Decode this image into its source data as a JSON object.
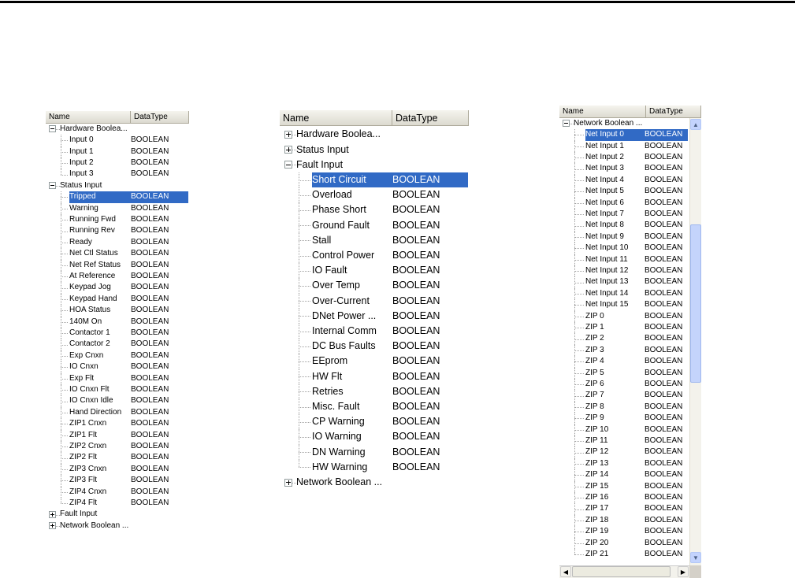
{
  "columns": {
    "name": "Name",
    "datatype": "DataType"
  },
  "colors": {
    "selection": "#316ac5",
    "header": "#ece9d8",
    "scrollbar": "#c4d4fb"
  },
  "panels": [
    {
      "id": "left",
      "rows": [
        {
          "level": 0,
          "label": "Hardware Boolea...",
          "expander": "minus"
        },
        {
          "level": 1,
          "label": "Input 0",
          "type": "BOOLEAN"
        },
        {
          "level": 1,
          "label": "Input 1",
          "type": "BOOLEAN"
        },
        {
          "level": 1,
          "label": "Input 2",
          "type": "BOOLEAN"
        },
        {
          "level": 1,
          "label": "Input 3",
          "type": "BOOLEAN"
        },
        {
          "level": 0,
          "label": "Status Input",
          "expander": "minus"
        },
        {
          "level": 1,
          "label": "Tripped",
          "type": "BOOLEAN",
          "selected": true
        },
        {
          "level": 1,
          "label": "Warning",
          "type": "BOOLEAN"
        },
        {
          "level": 1,
          "label": "Running Fwd",
          "type": "BOOLEAN"
        },
        {
          "level": 1,
          "label": "Running Rev",
          "type": "BOOLEAN"
        },
        {
          "level": 1,
          "label": "Ready",
          "type": "BOOLEAN"
        },
        {
          "level": 1,
          "label": "Net Ctl Status",
          "type": "BOOLEAN"
        },
        {
          "level": 1,
          "label": "Net Ref Status",
          "type": "BOOLEAN"
        },
        {
          "level": 1,
          "label": "At Reference",
          "type": "BOOLEAN"
        },
        {
          "level": 1,
          "label": "Keypad Jog",
          "type": "BOOLEAN"
        },
        {
          "level": 1,
          "label": "Keypad Hand",
          "type": "BOOLEAN"
        },
        {
          "level": 1,
          "label": "HOA Status",
          "type": "BOOLEAN"
        },
        {
          "level": 1,
          "label": "140M On",
          "type": "BOOLEAN"
        },
        {
          "level": 1,
          "label": "Contactor 1",
          "type": "BOOLEAN"
        },
        {
          "level": 1,
          "label": "Contactor 2",
          "type": "BOOLEAN"
        },
        {
          "level": 1,
          "label": "Exp Cnxn",
          "type": "BOOLEAN"
        },
        {
          "level": 1,
          "label": "IO Cnxn",
          "type": "BOOLEAN"
        },
        {
          "level": 1,
          "label": "Exp Flt",
          "type": "BOOLEAN"
        },
        {
          "level": 1,
          "label": "IO Cnxn Flt",
          "type": "BOOLEAN"
        },
        {
          "level": 1,
          "label": "IO Cnxn Idle",
          "type": "BOOLEAN"
        },
        {
          "level": 1,
          "label": "Hand Direction",
          "type": "BOOLEAN"
        },
        {
          "level": 1,
          "label": "ZIP1 Cnxn",
          "type": "BOOLEAN"
        },
        {
          "level": 1,
          "label": "ZIP1 Flt",
          "type": "BOOLEAN"
        },
        {
          "level": 1,
          "label": "ZIP2 Cnxn",
          "type": "BOOLEAN"
        },
        {
          "level": 1,
          "label": "ZIP2 Flt",
          "type": "BOOLEAN"
        },
        {
          "level": 1,
          "label": "ZIP3 Cnxn",
          "type": "BOOLEAN"
        },
        {
          "level": 1,
          "label": "ZIP3 Flt",
          "type": "BOOLEAN"
        },
        {
          "level": 1,
          "label": "ZIP4 Cnxn",
          "type": "BOOLEAN"
        },
        {
          "level": 1,
          "label": "ZIP4 Flt",
          "type": "BOOLEAN"
        },
        {
          "level": 0,
          "label": "Fault Input",
          "expander": "plus"
        },
        {
          "level": 0,
          "label": "Network Boolean ...",
          "expander": "plus"
        }
      ]
    },
    {
      "id": "middle",
      "rows": [
        {
          "level": 0,
          "label": "Hardware Boolea...",
          "expander": "plus"
        },
        {
          "level": 0,
          "label": "Status Input",
          "expander": "plus"
        },
        {
          "level": 0,
          "label": "Fault Input",
          "expander": "minus"
        },
        {
          "level": 1,
          "label": "Short Circuit",
          "type": "BOOLEAN",
          "selected": true
        },
        {
          "level": 1,
          "label": "Overload",
          "type": "BOOLEAN"
        },
        {
          "level": 1,
          "label": "Phase Short",
          "type": "BOOLEAN"
        },
        {
          "level": 1,
          "label": "Ground Fault",
          "type": "BOOLEAN"
        },
        {
          "level": 1,
          "label": "Stall",
          "type": "BOOLEAN"
        },
        {
          "level": 1,
          "label": "Control Power",
          "type": "BOOLEAN"
        },
        {
          "level": 1,
          "label": "IO Fault",
          "type": "BOOLEAN"
        },
        {
          "level": 1,
          "label": "Over Temp",
          "type": "BOOLEAN"
        },
        {
          "level": 1,
          "label": "Over-Current",
          "type": "BOOLEAN"
        },
        {
          "level": 1,
          "label": "DNet Power ...",
          "type": "BOOLEAN"
        },
        {
          "level": 1,
          "label": "Internal Comm",
          "type": "BOOLEAN"
        },
        {
          "level": 1,
          "label": "DC Bus Faults",
          "type": "BOOLEAN"
        },
        {
          "level": 1,
          "label": "EEprom",
          "type": "BOOLEAN"
        },
        {
          "level": 1,
          "label": "HW Flt",
          "type": "BOOLEAN"
        },
        {
          "level": 1,
          "label": "Retries",
          "type": "BOOLEAN"
        },
        {
          "level": 1,
          "label": "Misc. Fault",
          "type": "BOOLEAN"
        },
        {
          "level": 1,
          "label": "CP Warning",
          "type": "BOOLEAN"
        },
        {
          "level": 1,
          "label": "IO Warning",
          "type": "BOOLEAN"
        },
        {
          "level": 1,
          "label": "DN Warning",
          "type": "BOOLEAN"
        },
        {
          "level": 1,
          "label": "HW Warning",
          "type": "BOOLEAN"
        },
        {
          "level": 0,
          "label": "Network Boolean ...",
          "expander": "plus"
        }
      ]
    },
    {
      "id": "right",
      "rows": [
        {
          "level": 0,
          "label": "Network Boolean ...",
          "expander": "minus"
        },
        {
          "level": 1,
          "label": "Net Input 0",
          "type": "BOOLEAN",
          "selected": true
        },
        {
          "level": 1,
          "label": "Net Input 1",
          "type": "BOOLEAN"
        },
        {
          "level": 1,
          "label": "Net Input 2",
          "type": "BOOLEAN"
        },
        {
          "level": 1,
          "label": "Net Input 3",
          "type": "BOOLEAN"
        },
        {
          "level": 1,
          "label": "Net Input 4",
          "type": "BOOLEAN"
        },
        {
          "level": 1,
          "label": "Net Input 5",
          "type": "BOOLEAN"
        },
        {
          "level": 1,
          "label": "Net Input 6",
          "type": "BOOLEAN"
        },
        {
          "level": 1,
          "label": "Net Input 7",
          "type": "BOOLEAN"
        },
        {
          "level": 1,
          "label": "Net Input 8",
          "type": "BOOLEAN"
        },
        {
          "level": 1,
          "label": "Net Input 9",
          "type": "BOOLEAN"
        },
        {
          "level": 1,
          "label": "Net Input 10",
          "type": "BOOLEAN"
        },
        {
          "level": 1,
          "label": "Net Input 11",
          "type": "BOOLEAN"
        },
        {
          "level": 1,
          "label": "Net Input 12",
          "type": "BOOLEAN"
        },
        {
          "level": 1,
          "label": "Net Input 13",
          "type": "BOOLEAN"
        },
        {
          "level": 1,
          "label": "Net Input 14",
          "type": "BOOLEAN"
        },
        {
          "level": 1,
          "label": "Net Input 15",
          "type": "BOOLEAN"
        },
        {
          "level": 1,
          "label": "ZIP 0",
          "type": "BOOLEAN"
        },
        {
          "level": 1,
          "label": "ZIP 1",
          "type": "BOOLEAN"
        },
        {
          "level": 1,
          "label": "ZIP 2",
          "type": "BOOLEAN"
        },
        {
          "level": 1,
          "label": "ZIP 3",
          "type": "BOOLEAN"
        },
        {
          "level": 1,
          "label": "ZIP 4",
          "type": "BOOLEAN"
        },
        {
          "level": 1,
          "label": "ZIP 5",
          "type": "BOOLEAN"
        },
        {
          "level": 1,
          "label": "ZIP 6",
          "type": "BOOLEAN"
        },
        {
          "level": 1,
          "label": "ZIP 7",
          "type": "BOOLEAN"
        },
        {
          "level": 1,
          "label": "ZIP 8",
          "type": "BOOLEAN"
        },
        {
          "level": 1,
          "label": "ZIP 9",
          "type": "BOOLEAN"
        },
        {
          "level": 1,
          "label": "ZIP 10",
          "type": "BOOLEAN"
        },
        {
          "level": 1,
          "label": "ZIP 11",
          "type": "BOOLEAN"
        },
        {
          "level": 1,
          "label": "ZIP 12",
          "type": "BOOLEAN"
        },
        {
          "level": 1,
          "label": "ZIP 13",
          "type": "BOOLEAN"
        },
        {
          "level": 1,
          "label": "ZIP 14",
          "type": "BOOLEAN"
        },
        {
          "level": 1,
          "label": "ZIP 15",
          "type": "BOOLEAN"
        },
        {
          "level": 1,
          "label": "ZIP 16",
          "type": "BOOLEAN"
        },
        {
          "level": 1,
          "label": "ZIP 17",
          "type": "BOOLEAN"
        },
        {
          "level": 1,
          "label": "ZIP 18",
          "type": "BOOLEAN"
        },
        {
          "level": 1,
          "label": "ZIP 19",
          "type": "BOOLEAN"
        },
        {
          "level": 1,
          "label": "ZIP 20",
          "type": "BOOLEAN"
        },
        {
          "level": 1,
          "label": "ZIP 21",
          "type": "BOOLEAN"
        }
      ]
    }
  ]
}
